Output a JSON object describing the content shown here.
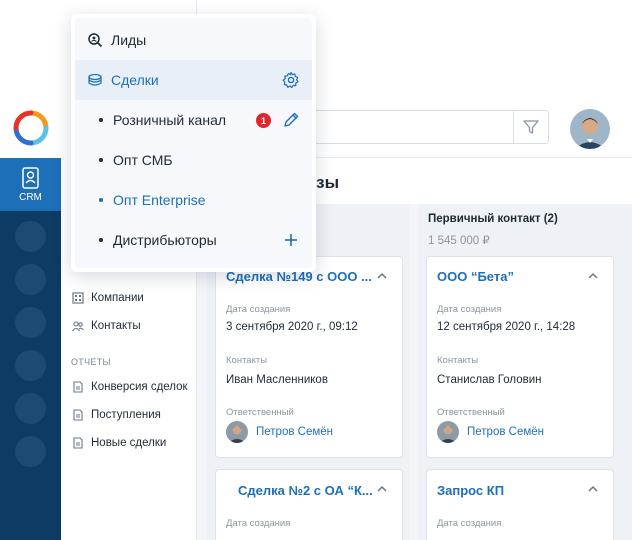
{
  "app": {
    "module_label": "CRM",
    "colors": {
      "primary": "#1d6fb8",
      "rail_dark": "#0e3b63",
      "badge": "#e0252d"
    }
  },
  "dropdown": {
    "items": [
      {
        "label": "Лиды",
        "icon": "search-icon"
      },
      {
        "label": "Сделки",
        "icon": "stack-icon",
        "active": true,
        "action_icon": "gear-icon"
      },
      {
        "label": "Розничный канал",
        "badge": "1",
        "action_icon": "pencil-icon"
      },
      {
        "label": "Опт СМБ"
      },
      {
        "label": "Опт Enterprise",
        "highlighted": true
      },
      {
        "label": "Дистрибьюторы",
        "action_icon": "plus-icon"
      }
    ]
  },
  "nav": {
    "section_reports": "ОТЧЕТЫ",
    "directory_items": [
      {
        "label": "Компании",
        "icon": "building-icon"
      },
      {
        "label": "Контакты",
        "icon": "contacts-icon"
      }
    ],
    "report_items": [
      {
        "label": "Конверсия сделок",
        "icon": "document-icon"
      },
      {
        "label": "Поступления",
        "icon": "document-icon"
      },
      {
        "label": "Новые сделки",
        "icon": "document-icon"
      }
    ]
  },
  "header": {
    "filter_icon": "filter-icon"
  },
  "page": {
    "title_fragment": "казы"
  },
  "board": {
    "column_right": {
      "title": "Первичный контакт (2)",
      "sum": "1 545 000 ₽"
    },
    "cards": [
      {
        "title": "Сделка №149 с ООО ...",
        "created_label": "Дата создания",
        "created_value": "3 сентября 2020 г., 09:12",
        "contacts_label": "Контакты",
        "contacts_value": "Иван Масленников",
        "owner_label": "Ответственный",
        "owner_value": "Петров Семён"
      },
      {
        "title": "ООО “Бета”",
        "created_label": "Дата создания",
        "created_value": "12 сентября 2020 г., 14:28",
        "contacts_label": "Контакты",
        "contacts_value": "Станислав Головин",
        "owner_label": "Ответственный",
        "owner_value": "Петров Семён"
      },
      {
        "title": "Сделка №2 с ОА “К...",
        "created_label": "Дата создания"
      },
      {
        "title": "Запрос КП",
        "created_label": "Дата создания"
      }
    ]
  }
}
